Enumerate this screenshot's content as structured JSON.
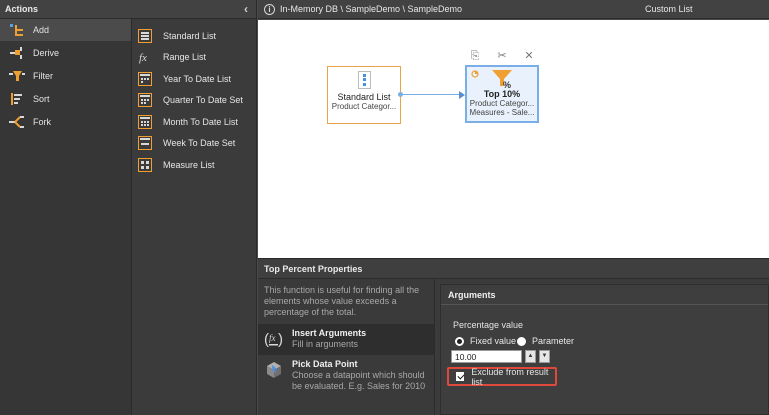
{
  "actions": {
    "title": "Actions",
    "collapse_glyph": "‹",
    "categories": [
      {
        "label": "Add",
        "icon": "add-icon"
      },
      {
        "label": "Derive",
        "icon": "derive-icon"
      },
      {
        "label": "Filter",
        "icon": "filter-icon"
      },
      {
        "label": "Sort",
        "icon": "sort-icon"
      },
      {
        "label": "Fork",
        "icon": "fork-icon"
      }
    ],
    "items": [
      {
        "label": "Standard List",
        "icon": "standard-list-icon"
      },
      {
        "label": "Range List",
        "icon": "range-list-icon"
      },
      {
        "label": "Year To Date List",
        "icon": "calendar-icon"
      },
      {
        "label": "Quarter To Date Set",
        "icon": "calendar-icon"
      },
      {
        "label": "Month To Date List",
        "icon": "calendar-icon"
      },
      {
        "label": "Week To Date Set",
        "icon": "calendar-icon"
      },
      {
        "label": "Measure List",
        "icon": "measure-list-icon"
      }
    ]
  },
  "topbar": {
    "info_glyph": "i",
    "breadcrumb": "In-Memory DB \\ SampleDemo \\ SampleDemo",
    "list_type": "Custom List"
  },
  "canvas": {
    "nodes": [
      {
        "title": "Standard List",
        "subtitle": "Product Categor..."
      },
      {
        "title": "Top 10%",
        "subtitle": "Product Categor...",
        "subtitle2": "Measures - Sale..."
      }
    ],
    "tool_glyphs": {
      "copy": "⎘",
      "cut": "✂",
      "delete": "✕"
    }
  },
  "properties": {
    "title": "Top Percent Properties",
    "description": "This function is useful for finding all the elements whose value exceeds a percentage of the total.",
    "panels": [
      {
        "title": "Insert Arguments",
        "subtitle": "Fill in arguments"
      },
      {
        "title": "Pick Data Point",
        "subtitle": "Choose a datapoint which should be evaluated. E.g. Sales for 2010"
      }
    ],
    "arguments": {
      "title": "Arguments",
      "percentage_label": "Percentage value",
      "fixed_label": "Fixed value",
      "parameter_label": "Parameter",
      "value": "10.00",
      "spin_up": "▲",
      "spin_down": "▼",
      "exclude_label": "Exclude from result list",
      "exclude_checked": true
    }
  },
  "colors": {
    "accent_orange": "#f0a030",
    "selection_blue": "#7aaee6",
    "highlight_red": "#e0483c"
  }
}
